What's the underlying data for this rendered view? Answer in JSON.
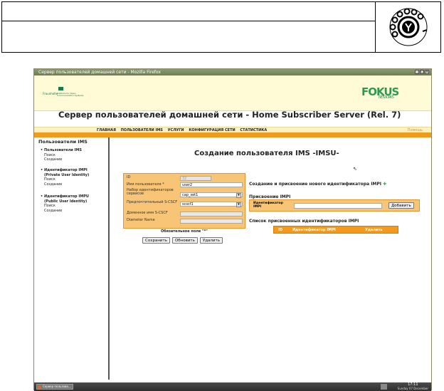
{
  "window": {
    "title": "Сервер пользователей домашней сети - Mozilla Firefox"
  },
  "banner": {
    "org_name": "Fraunhofer",
    "institute": "Institute for Open Communication Systems",
    "brand": "FOKUS",
    "brand_sub": "NETWORKS"
  },
  "app": {
    "title": "Сервер пользователей домашней сети - Home Subscriber Server (Rel. 7)"
  },
  "nav": {
    "items": [
      "ГЛАВНАЯ",
      "ПОЛЬЗОВАТЕЛИ IMS",
      "УСЛУГИ",
      "КОНФИГУРАЦИЯ СЕТИ",
      "СТАТИСТИКА"
    ],
    "help": "Помощь"
  },
  "sidebar": {
    "title": "Пользователи IMS",
    "groups": [
      {
        "head": "Пользователи IMS",
        "head2": "",
        "links": [
          "Поиск",
          "Создание"
        ]
      },
      {
        "head": "Идентификатор IMPI",
        "head2": "(Private User Identity)",
        "links": [
          "Поиск",
          "Создание"
        ]
      },
      {
        "head": "Идентификатор IMPU",
        "head2": "(Public User Identity)",
        "links": [
          "Поиск",
          "Создание"
        ]
      }
    ]
  },
  "main": {
    "title": "Создание пользователя IMS -IMSU-",
    "form": {
      "id_label": "ID",
      "id_value": "32",
      "username_label": "Имя пользователя *",
      "username_value": "user2",
      "capset_label": "Набор идентификаторов сервисов",
      "capset_value": "cap_set1",
      "scscf_label": "Предпочтительный S-CSCF",
      "scscf_value": "scscf1",
      "scscf_domain_label": "Доменное имя S-CSCF",
      "diameter_label": "Diameter Name"
    },
    "required_note": "Обязательное поле \"*\"",
    "buttons": {
      "save": "Сохранить",
      "refresh": "Обновить",
      "delete": "Удалить"
    },
    "impi_create": "Создание и присвоение нового идентификатора IMPI",
    "assign_title": "Присвоение IMPI",
    "assign_label": "Идентификатор IMPI",
    "assign_button": "Добавить",
    "list_title": "Список присвоенных идентификаторов IMPI",
    "list_cols": [
      "ID",
      "Идентификатор IMPI",
      "Удалить"
    ]
  },
  "taskbar": {
    "task": "Сервер пользова...",
    "time": "17:11",
    "date": "Sunday 07 December"
  }
}
